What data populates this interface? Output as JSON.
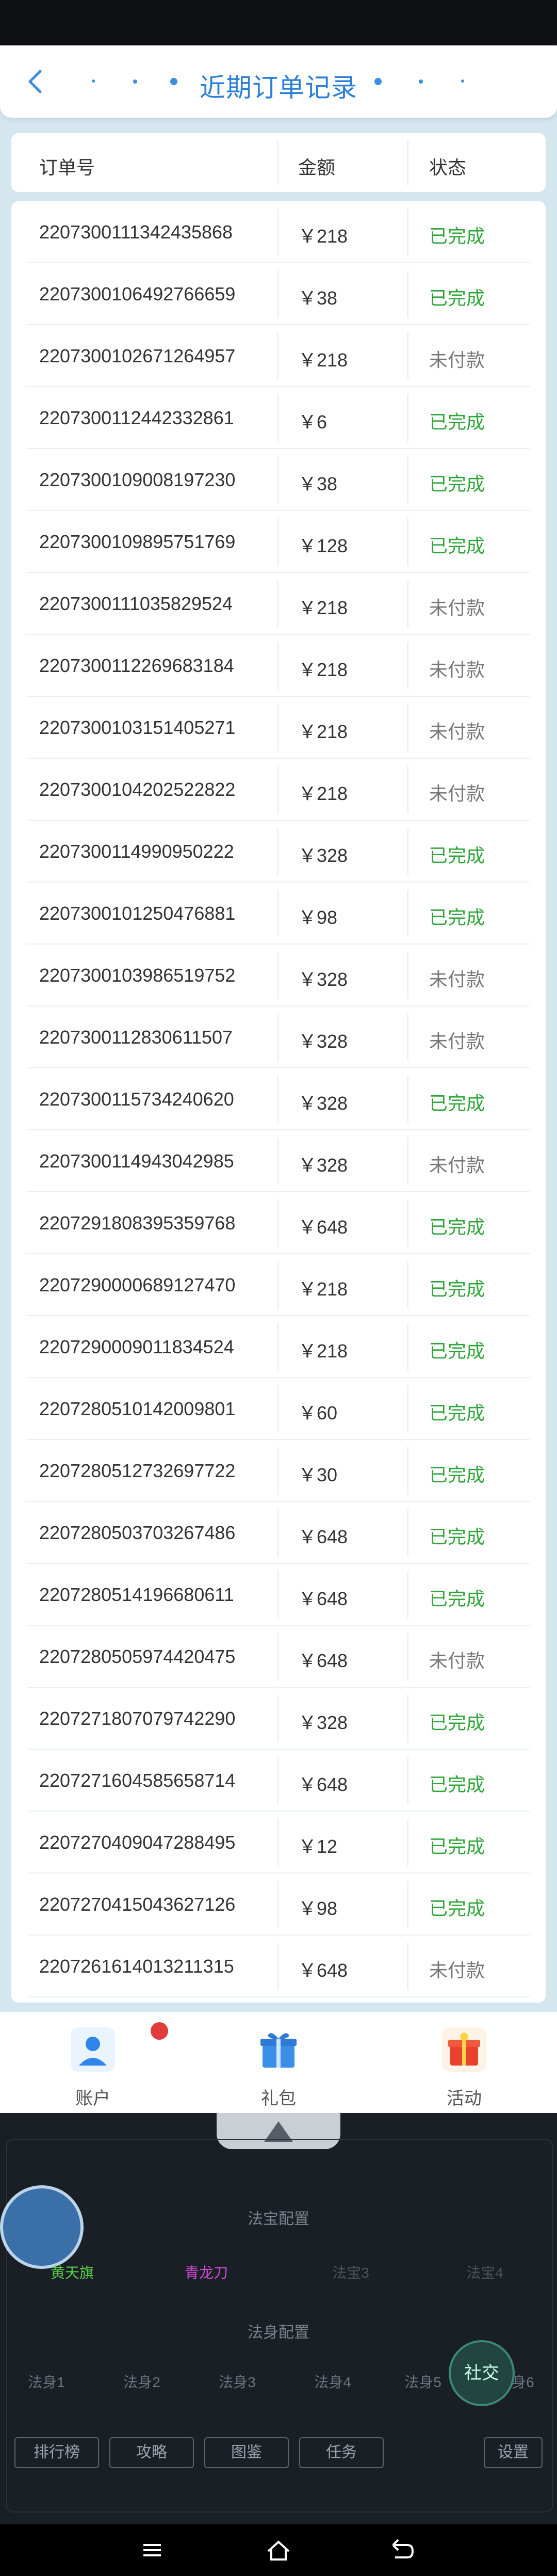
{
  "header": {
    "title": "近期订单记录",
    "back_icon": "chevron-left-icon"
  },
  "columns": {
    "order_no": "订单号",
    "amount": "金额",
    "status": "状态"
  },
  "colors": {
    "accent": "#2a7fd6",
    "done": "#2fa53a",
    "unpaid": "#777777"
  },
  "orders": [
    {
      "no": "2207300111342435868",
      "amount": "￥218",
      "status": "已完成",
      "done": true
    },
    {
      "no": "2207300106492766659",
      "amount": "￥38",
      "status": "已完成",
      "done": true
    },
    {
      "no": "2207300102671264957",
      "amount": "￥218",
      "status": "未付款",
      "done": false
    },
    {
      "no": "2207300112442332861",
      "amount": "￥6",
      "status": "已完成",
      "done": true
    },
    {
      "no": "2207300109008197230",
      "amount": "￥38",
      "status": "已完成",
      "done": true
    },
    {
      "no": "2207300109895751769",
      "amount": "￥128",
      "status": "已完成",
      "done": true
    },
    {
      "no": "2207300111035829524",
      "amount": "￥218",
      "status": "未付款",
      "done": false
    },
    {
      "no": "2207300112269683184",
      "amount": "￥218",
      "status": "未付款",
      "done": false
    },
    {
      "no": "2207300103151405271",
      "amount": "￥218",
      "status": "未付款",
      "done": false
    },
    {
      "no": "2207300104202522822",
      "amount": "￥218",
      "status": "未付款",
      "done": false
    },
    {
      "no": "2207300114990950222",
      "amount": "￥328",
      "status": "已完成",
      "done": true
    },
    {
      "no": "2207300101250476881",
      "amount": "￥98",
      "status": "已完成",
      "done": true
    },
    {
      "no": "2207300103986519752",
      "amount": "￥328",
      "status": "未付款",
      "done": false
    },
    {
      "no": "2207300112830611507",
      "amount": "￥328",
      "status": "未付款",
      "done": false
    },
    {
      "no": "2207300115734240620",
      "amount": "￥328",
      "status": "已完成",
      "done": true
    },
    {
      "no": "2207300114943042985",
      "amount": "￥328",
      "status": "未付款",
      "done": false
    },
    {
      "no": "2207291808395359768",
      "amount": "￥648",
      "status": "已完成",
      "done": true
    },
    {
      "no": "2207290000689127470",
      "amount": "￥218",
      "status": "已完成",
      "done": true
    },
    {
      "no": "2207290009011834524",
      "amount": "￥218",
      "status": "已完成",
      "done": true
    },
    {
      "no": "2207280510142009801",
      "amount": "￥60",
      "status": "已完成",
      "done": true
    },
    {
      "no": "2207280512732697722",
      "amount": "￥30",
      "status": "已完成",
      "done": true
    },
    {
      "no": "2207280503703267486",
      "amount": "￥648",
      "status": "已完成",
      "done": true
    },
    {
      "no": "2207280514196680611",
      "amount": "￥648",
      "status": "已完成",
      "done": true
    },
    {
      "no": "2207280505974420475",
      "amount": "￥648",
      "status": "未付款",
      "done": false
    },
    {
      "no": "2207271807079742290",
      "amount": "￥328",
      "status": "已完成",
      "done": true
    },
    {
      "no": "2207271604585658714",
      "amount": "￥648",
      "status": "已完成",
      "done": true
    },
    {
      "no": "2207270409047288495",
      "amount": "￥12",
      "status": "已完成",
      "done": true
    },
    {
      "no": "2207270415043627126",
      "amount": "￥98",
      "status": "已完成",
      "done": true
    },
    {
      "no": "2207261614013211315",
      "amount": "￥648",
      "status": "未付款",
      "done": false
    }
  ],
  "bottom_nav": [
    {
      "label": "账户",
      "icon": "account-icon"
    },
    {
      "label": "礼包",
      "icon": "gift-icon"
    },
    {
      "label": "活动",
      "icon": "activity-icon"
    }
  ],
  "game": {
    "treasure_title": "法宝配置",
    "body_title": "法身配置",
    "treasure_slots": [
      "黄天旗",
      "青龙刀",
      "法宝3",
      "法宝4"
    ],
    "body_slots": [
      "法身1",
      "法身2",
      "法身3",
      "法身4",
      "法身5",
      "法身6"
    ],
    "buttons": [
      "排行榜",
      "攻略",
      "图鉴",
      "任务",
      "设置"
    ],
    "social": "社交"
  }
}
